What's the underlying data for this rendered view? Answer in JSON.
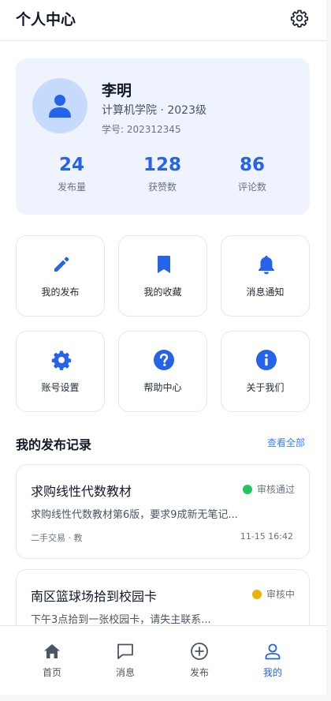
{
  "header": {
    "title": "个人中心"
  },
  "profile": {
    "name": "李明",
    "department": "计算机学院 · 2023级",
    "student_id": "学号: 202312345",
    "stats": [
      {
        "value": "24",
        "label": "发布量"
      },
      {
        "value": "128",
        "label": "获赞数"
      },
      {
        "value": "86",
        "label": "评论数"
      }
    ]
  },
  "menu": [
    {
      "label": "我的发布",
      "icon": "pencil-icon"
    },
    {
      "label": "我的收藏",
      "icon": "bookmark-icon"
    },
    {
      "label": "消息通知",
      "icon": "bell-icon"
    },
    {
      "label": "账号设置",
      "icon": "cog-icon"
    },
    {
      "label": "帮助中心",
      "icon": "question-icon"
    },
    {
      "label": "关于我们",
      "icon": "info-icon"
    }
  ],
  "records": {
    "title": "我的发布记录",
    "view_all": "查看全部",
    "items": [
      {
        "title": "求购线性代数教材",
        "status": "审核通过",
        "status_color": "#22c55e",
        "desc": "求购线性代数教材第6版，要求9成新无笔记...",
        "tags": "二手交易 · 教",
        "time": "11-15 16:42"
      },
      {
        "title": "南区篮球场拾到校园卡",
        "status": "审核中",
        "status_color": "#eab308",
        "desc": "下午3点拾到一张校园卡，请失主联系..."
      }
    ]
  },
  "tabbar": [
    {
      "label": "首页",
      "icon": "home-icon"
    },
    {
      "label": "消息",
      "icon": "chat-icon"
    },
    {
      "label": "发布",
      "icon": "plus-circle-icon"
    },
    {
      "label": "我的",
      "icon": "user-icon",
      "active": true
    }
  ],
  "colors": {
    "accent": "#2563eb",
    "card_bg": "#eef3fd"
  }
}
